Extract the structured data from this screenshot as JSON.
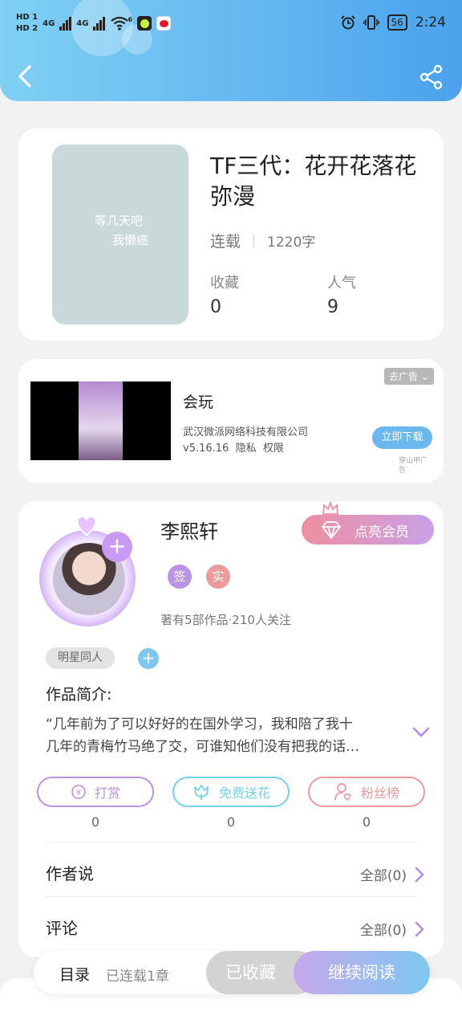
{
  "status_bar": {
    "hd1": "HD 1",
    "hd2": "HD 2",
    "net1": "4G",
    "net2": "4G",
    "wifi_badge": "6",
    "battery": "56",
    "time": "2:24"
  },
  "book": {
    "cover_line1": "等几天吧",
    "cover_line2": "我懒癌",
    "title": "TF三代：花开花落花弥漫",
    "status": "连载",
    "word_count": "1220字",
    "favorites_label": "收藏",
    "favorites_value": "0",
    "popularity_label": "人气",
    "popularity_value": "9"
  },
  "ad": {
    "tag": "去广告",
    "app_name": "会玩",
    "company": "武汉微派网络科技有限公司",
    "version_line": "v5.16.16  隐私  权限",
    "download_label": "立即下载",
    "source_line1": "穿山甲广",
    "source_line2": "告"
  },
  "author": {
    "name": "李熙轩",
    "vip_label": "点亮会员",
    "badge_signed": "签",
    "badge_verified": "实",
    "stats": "著有5部作品·210人关注",
    "tag": "明星同人"
  },
  "intro": {
    "heading": "作品简介:",
    "line1": "“几年前为了可以好好的在国外学习，我和陪了我十",
    "line2": "几年的青梅竹马绝了交，可谁知他们没有把我的话…"
  },
  "actions": {
    "reward_label": "打赏",
    "reward_count": "0",
    "flower_label": "免费送花",
    "flower_count": "0",
    "fans_label": "粉丝榜",
    "fans_count": "0"
  },
  "sections": {
    "author_says_label": "作者说",
    "author_says_all": "全部(0)",
    "comments_label": "评论",
    "comments_all": "全部(0)"
  },
  "bottom_bar": {
    "toc_label": "目录",
    "chapters_label": "已连载1章",
    "saved_label": "已收藏",
    "continue_label": "继续阅读"
  },
  "colors": {
    "header_blue": "#64b8f0",
    "reward_purple": "#b892e0",
    "flower_cyan": "#76d0ea",
    "fans_red": "#ec9aa0",
    "chevron_purple": "#b48ee6"
  }
}
